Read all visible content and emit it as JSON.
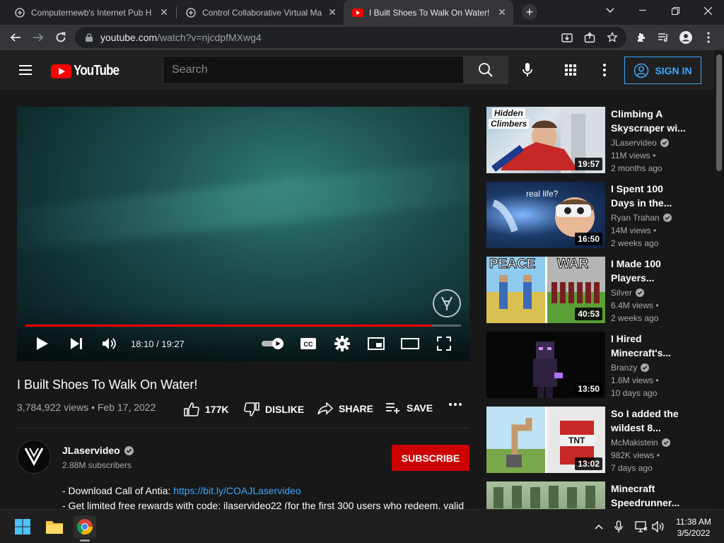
{
  "browser": {
    "tabs": [
      {
        "title": "Computernewb's Internet Pub H",
        "active": false
      },
      {
        "title": "Control Collaborative Virtual Ma",
        "active": false
      },
      {
        "title": "I Built Shoes To Walk On Water!",
        "active": true
      }
    ],
    "url_host": "youtube.com",
    "url_rest": "/watch?v=njcdpfMXwg4"
  },
  "masthead": {
    "logo_text": "YouTube",
    "search_placeholder": "Search",
    "signin_label": "SIGN IN"
  },
  "player": {
    "time": "18:10 / 19:27",
    "progress": 0.9342,
    "cc_label": "CC"
  },
  "video": {
    "title": "I Built Shoes To Walk On Water!",
    "meta": "3,784,922 views • Feb 17, 2022",
    "likes": "177K",
    "dislike_label": "DISLIKE",
    "share_label": "SHARE",
    "save_label": "SAVE",
    "channel": "JLaservideo",
    "subscribers": "2.88M subscribers",
    "subscribe_label": "SUBSCRIBE",
    "desc_line1_prefix": "- Download Call of Antia: ",
    "desc_line1_link": "https://bit.ly/COAJLaservideo",
    "desc_line2": "- Get limited free rewards with code: jlaservideo22 (for the first 300 users who redeem, valid"
  },
  "recommendations": [
    {
      "title_l1": "Climbing A",
      "title_l2": "Skyscraper wi...",
      "channel": "JLaservideo",
      "views": "11M views •",
      "age": "2 months ago",
      "duration": "19:57",
      "thumb_text": "Hidden Climbers",
      "colors": [
        "#6fa7c9",
        "#d9d9d9"
      ]
    },
    {
      "title_l1": "I Spent 100",
      "title_l2": "Days in the...",
      "channel": "Ryan Trahan",
      "views": "14M views •",
      "age": "2 weeks ago",
      "duration": "16:50",
      "thumb_text": "real life?",
      "colors": [
        "#1d3b6b",
        "#8cb6e8"
      ]
    },
    {
      "title_l1": "I Made 100",
      "title_l2": "Players...",
      "channel": "Silver",
      "views": "6.4M views •",
      "age": "2 weeks ago",
      "duration": "40:53",
      "thumb_text_a": "PEACE",
      "thumb_text_b": "WAR",
      "colors": [
        "#6bb33c",
        "#e6d36a"
      ]
    },
    {
      "title_l1": "I Hired",
      "title_l2": "Minecraft's...",
      "channel": "Branzy",
      "views": "1.6M views •",
      "age": "10 days ago",
      "duration": "13:50",
      "colors": [
        "#0a0a0a",
        "#3c2b55"
      ]
    },
    {
      "title_l1": "So I added the",
      "title_l2": "wildest 8...",
      "channel": "McMakistein",
      "views": "982K views •",
      "age": "7 days ago",
      "duration": "13:02",
      "thumb_text": "TNT",
      "colors": [
        "#bfe3f5",
        "#79a84a"
      ]
    },
    {
      "title_l1": "Minecraft",
      "title_l2": "Speedrunner...",
      "colors": [
        "#9bb38f",
        "#56704b"
      ]
    }
  ],
  "taskbar": {
    "time": "11:38 AM",
    "date": "3/5/2022"
  }
}
